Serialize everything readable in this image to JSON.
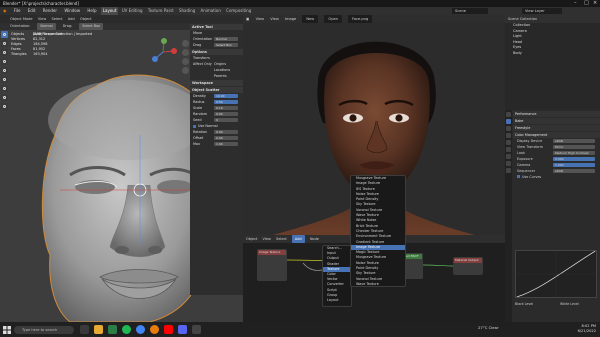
{
  "window": {
    "title": "Blender* [X:\\projects\\character.blend]"
  },
  "menu": {
    "items": [
      "File",
      "Edit",
      "Render",
      "Window",
      "Help"
    ],
    "workspaces": [
      "Layout",
      "UV Editing",
      "Texture Paint",
      "Shading",
      "Animation",
      "Compositing"
    ],
    "active_workspace": "Layout",
    "scene": "Scene",
    "view_layer": "View Layer"
  },
  "viewport": {
    "header": [
      "Object Mode",
      "View",
      "Select",
      "Add",
      "Object"
    ],
    "tool_settings": {
      "orientation_label": "Orientation:",
      "orientation_value": "Normal",
      "drag_label": "Drag:",
      "drag_value": "Select Box"
    },
    "stats": [
      {
        "label": "User Perspective",
        "value": ""
      },
      {
        "label": "(130) Scene Collection | Imported",
        "value": ""
      },
      {
        "label": "Objects",
        "value": "1 / 8"
      },
      {
        "label": "Vertices",
        "value": "82,312"
      },
      {
        "label": "Edges",
        "value": "164,598"
      },
      {
        "label": "Faces",
        "value": "81,952"
      },
      {
        "label": "Triangles",
        "value": "163,904"
      }
    ]
  },
  "tool_panel": {
    "active_tool_title": "Active Tool",
    "tool_name": "Move",
    "orientation_label": "Orientation",
    "orientation_value": "Normal",
    "drag_label": "Drag",
    "drag_value": "Select Box",
    "options_title": "Options",
    "transform_label": "Transform",
    "affect_only_label": "Affect Only",
    "origins_label": "Origins",
    "locations_label": "Locations",
    "parents_label": "Parents",
    "workspace_title": "Workspace",
    "scatter_title": "Object Scatter",
    "fields": [
      {
        "label": "Density",
        "value": "10.00"
      },
      {
        "label": "Radius",
        "value": "0.50"
      },
      {
        "label": "Scale",
        "value": "0.10"
      },
      {
        "label": "Random",
        "value": "0.00"
      },
      {
        "label": "Seed",
        "value": "0"
      }
    ],
    "use_normal_label": "Use Normal",
    "extra_fields": [
      {
        "label": "Rotation",
        "value": "0.00"
      },
      {
        "label": "Offset",
        "value": "0.00"
      },
      {
        "label": "Max",
        "value": "1.00"
      }
    ]
  },
  "image_view": {
    "header": [
      "View",
      "View",
      "Image",
      "New",
      "Open"
    ],
    "image_name": "Face.png"
  },
  "add_menu": {
    "search_label": "Search...",
    "items": [
      "Musgrave Texture",
      "Image Texture",
      "IES Texture",
      "Noise Texture",
      "Point Density",
      "Sky Texture",
      "Voronoi Texture",
      "Wave Texture",
      "White Noise",
      "Brick Texture",
      "Checker Texture",
      "Environment Texture",
      "Gradient Texture",
      "Image Texture",
      "Magic Texture",
      "Musgrave Texture",
      "Noise Texture",
      "Point Density",
      "Sky Texture",
      "Voronoi Texture",
      "Wave Texture"
    ],
    "highlighted_index": 13,
    "categories": [
      "Search...",
      "Input",
      "Output",
      "Shader",
      "Texture",
      "Color",
      "Vector",
      "Converter",
      "Script",
      "Group",
      "Layout"
    ],
    "highlighted_category": 4
  },
  "node_editor": {
    "header": [
      "Object",
      "View",
      "Select",
      "Add",
      "Node"
    ],
    "active": "Add",
    "nodes": [
      "Image Texture",
      "Principled BSDF",
      "Material Output"
    ]
  },
  "outliner": {
    "title": "Scene Collection",
    "items": [
      "Collection",
      "Camera",
      "Light",
      "Head",
      "Eyes",
      "Body"
    ]
  },
  "properties": {
    "sections": [
      {
        "title": "Performance",
        "rows": []
      },
      {
        "title": "Bake",
        "rows": []
      },
      {
        "title": "Freestyle",
        "rows": []
      },
      {
        "title": "Color Management",
        "rows": [
          {
            "label": "Display Device",
            "value": "sRGB"
          },
          {
            "label": "View Transform",
            "value": "Filmic"
          },
          {
            "label": "Look",
            "value": "Medium High Contrast"
          },
          {
            "label": "Exposure",
            "value": "0.000"
          },
          {
            "label": "Gamma",
            "value": "1.000"
          },
          {
            "label": "Sequencer",
            "value": "sRGB"
          }
        ]
      }
    ],
    "curves_label": "Use Curves",
    "black_level_label": "Black Level",
    "white_level_label": "White Level"
  },
  "taskbar": {
    "search_placeholder": "Type here to search",
    "weather": "27°C  Clear",
    "time": "8:02 PM",
    "date": "6/21/2022"
  },
  "colors": {
    "accent": "#4772b3",
    "viewport_bg": "#3d3d3d",
    "panel_bg": "#2b2b2b"
  }
}
